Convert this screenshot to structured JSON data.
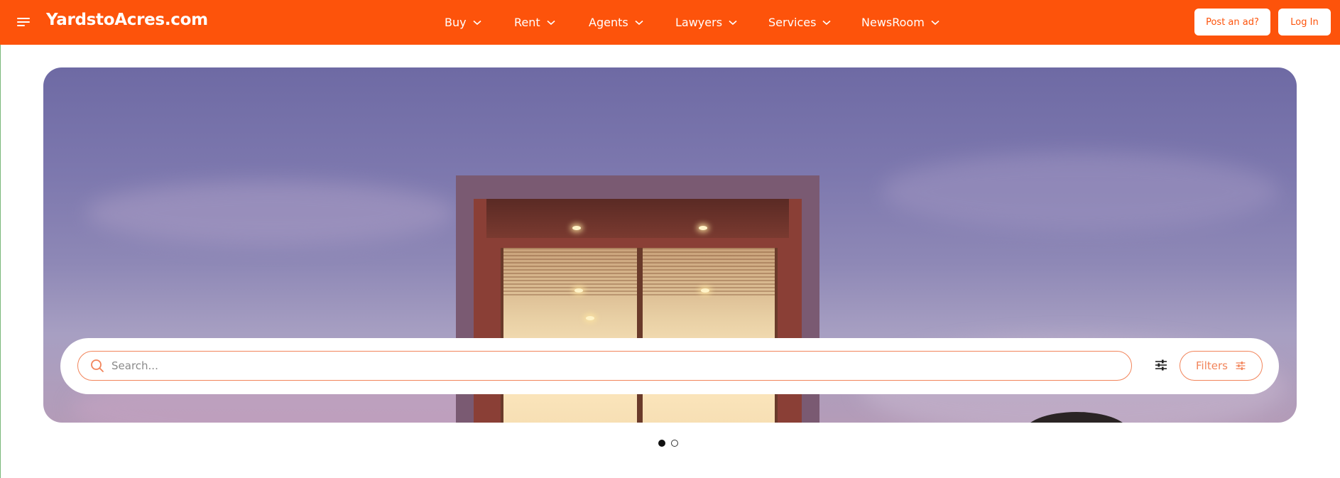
{
  "header": {
    "logo": "YardstoAcres.com",
    "nav": [
      {
        "label": "Buy"
      },
      {
        "label": "Rent"
      },
      {
        "label": "Agents"
      },
      {
        "label": "Lawyers"
      },
      {
        "label": "Services"
      },
      {
        "label": "NewsRoom"
      }
    ],
    "post_ad_label": "Post an ad?",
    "login_label": "Log In"
  },
  "search": {
    "placeholder": "Search...",
    "value": "",
    "filters_label": "Filters"
  },
  "carousel": {
    "slides": 2,
    "active_slide": 1
  },
  "colors": {
    "brand": "#fd530b",
    "accent_outline": "#f2845a"
  },
  "icons": [
    "menu-icon",
    "chevron-down-icon",
    "search-icon",
    "sliders-icon"
  ]
}
